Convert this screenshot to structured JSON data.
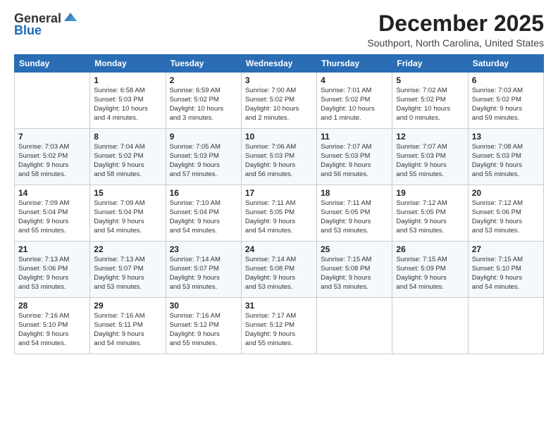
{
  "header": {
    "logo_general": "General",
    "logo_blue": "Blue",
    "month_title": "December 2025",
    "subtitle": "Southport, North Carolina, United States"
  },
  "weekdays": [
    "Sunday",
    "Monday",
    "Tuesday",
    "Wednesday",
    "Thursday",
    "Friday",
    "Saturday"
  ],
  "weeks": [
    [
      {
        "day": "",
        "info": ""
      },
      {
        "day": "1",
        "info": "Sunrise: 6:58 AM\nSunset: 5:03 PM\nDaylight: 10 hours\nand 4 minutes."
      },
      {
        "day": "2",
        "info": "Sunrise: 6:59 AM\nSunset: 5:02 PM\nDaylight: 10 hours\nand 3 minutes."
      },
      {
        "day": "3",
        "info": "Sunrise: 7:00 AM\nSunset: 5:02 PM\nDaylight: 10 hours\nand 2 minutes."
      },
      {
        "day": "4",
        "info": "Sunrise: 7:01 AM\nSunset: 5:02 PM\nDaylight: 10 hours\nand 1 minute."
      },
      {
        "day": "5",
        "info": "Sunrise: 7:02 AM\nSunset: 5:02 PM\nDaylight: 10 hours\nand 0 minutes."
      },
      {
        "day": "6",
        "info": "Sunrise: 7:03 AM\nSunset: 5:02 PM\nDaylight: 9 hours\nand 59 minutes."
      }
    ],
    [
      {
        "day": "7",
        "info": "Sunrise: 7:03 AM\nSunset: 5:02 PM\nDaylight: 9 hours\nand 58 minutes."
      },
      {
        "day": "8",
        "info": "Sunrise: 7:04 AM\nSunset: 5:02 PM\nDaylight: 9 hours\nand 58 minutes."
      },
      {
        "day": "9",
        "info": "Sunrise: 7:05 AM\nSunset: 5:03 PM\nDaylight: 9 hours\nand 57 minutes."
      },
      {
        "day": "10",
        "info": "Sunrise: 7:06 AM\nSunset: 5:03 PM\nDaylight: 9 hours\nand 56 minutes."
      },
      {
        "day": "11",
        "info": "Sunrise: 7:07 AM\nSunset: 5:03 PM\nDaylight: 9 hours\nand 56 minutes."
      },
      {
        "day": "12",
        "info": "Sunrise: 7:07 AM\nSunset: 5:03 PM\nDaylight: 9 hours\nand 55 minutes."
      },
      {
        "day": "13",
        "info": "Sunrise: 7:08 AM\nSunset: 5:03 PM\nDaylight: 9 hours\nand 55 minutes."
      }
    ],
    [
      {
        "day": "14",
        "info": "Sunrise: 7:09 AM\nSunset: 5:04 PM\nDaylight: 9 hours\nand 55 minutes."
      },
      {
        "day": "15",
        "info": "Sunrise: 7:09 AM\nSunset: 5:04 PM\nDaylight: 9 hours\nand 54 minutes."
      },
      {
        "day": "16",
        "info": "Sunrise: 7:10 AM\nSunset: 5:04 PM\nDaylight: 9 hours\nand 54 minutes."
      },
      {
        "day": "17",
        "info": "Sunrise: 7:11 AM\nSunset: 5:05 PM\nDaylight: 9 hours\nand 54 minutes."
      },
      {
        "day": "18",
        "info": "Sunrise: 7:11 AM\nSunset: 5:05 PM\nDaylight: 9 hours\nand 53 minutes."
      },
      {
        "day": "19",
        "info": "Sunrise: 7:12 AM\nSunset: 5:05 PM\nDaylight: 9 hours\nand 53 minutes."
      },
      {
        "day": "20",
        "info": "Sunrise: 7:12 AM\nSunset: 5:06 PM\nDaylight: 9 hours\nand 53 minutes."
      }
    ],
    [
      {
        "day": "21",
        "info": "Sunrise: 7:13 AM\nSunset: 5:06 PM\nDaylight: 9 hours\nand 53 minutes."
      },
      {
        "day": "22",
        "info": "Sunrise: 7:13 AM\nSunset: 5:07 PM\nDaylight: 9 hours\nand 53 minutes."
      },
      {
        "day": "23",
        "info": "Sunrise: 7:14 AM\nSunset: 5:07 PM\nDaylight: 9 hours\nand 53 minutes."
      },
      {
        "day": "24",
        "info": "Sunrise: 7:14 AM\nSunset: 5:08 PM\nDaylight: 9 hours\nand 53 minutes."
      },
      {
        "day": "25",
        "info": "Sunrise: 7:15 AM\nSunset: 5:08 PM\nDaylight: 9 hours\nand 53 minutes."
      },
      {
        "day": "26",
        "info": "Sunrise: 7:15 AM\nSunset: 5:09 PM\nDaylight: 9 hours\nand 54 minutes."
      },
      {
        "day": "27",
        "info": "Sunrise: 7:15 AM\nSunset: 5:10 PM\nDaylight: 9 hours\nand 54 minutes."
      }
    ],
    [
      {
        "day": "28",
        "info": "Sunrise: 7:16 AM\nSunset: 5:10 PM\nDaylight: 9 hours\nand 54 minutes."
      },
      {
        "day": "29",
        "info": "Sunrise: 7:16 AM\nSunset: 5:11 PM\nDaylight: 9 hours\nand 54 minutes."
      },
      {
        "day": "30",
        "info": "Sunrise: 7:16 AM\nSunset: 5:12 PM\nDaylight: 9 hours\nand 55 minutes."
      },
      {
        "day": "31",
        "info": "Sunrise: 7:17 AM\nSunset: 5:12 PM\nDaylight: 9 hours\nand 55 minutes."
      },
      {
        "day": "",
        "info": ""
      },
      {
        "day": "",
        "info": ""
      },
      {
        "day": "",
        "info": ""
      }
    ]
  ]
}
